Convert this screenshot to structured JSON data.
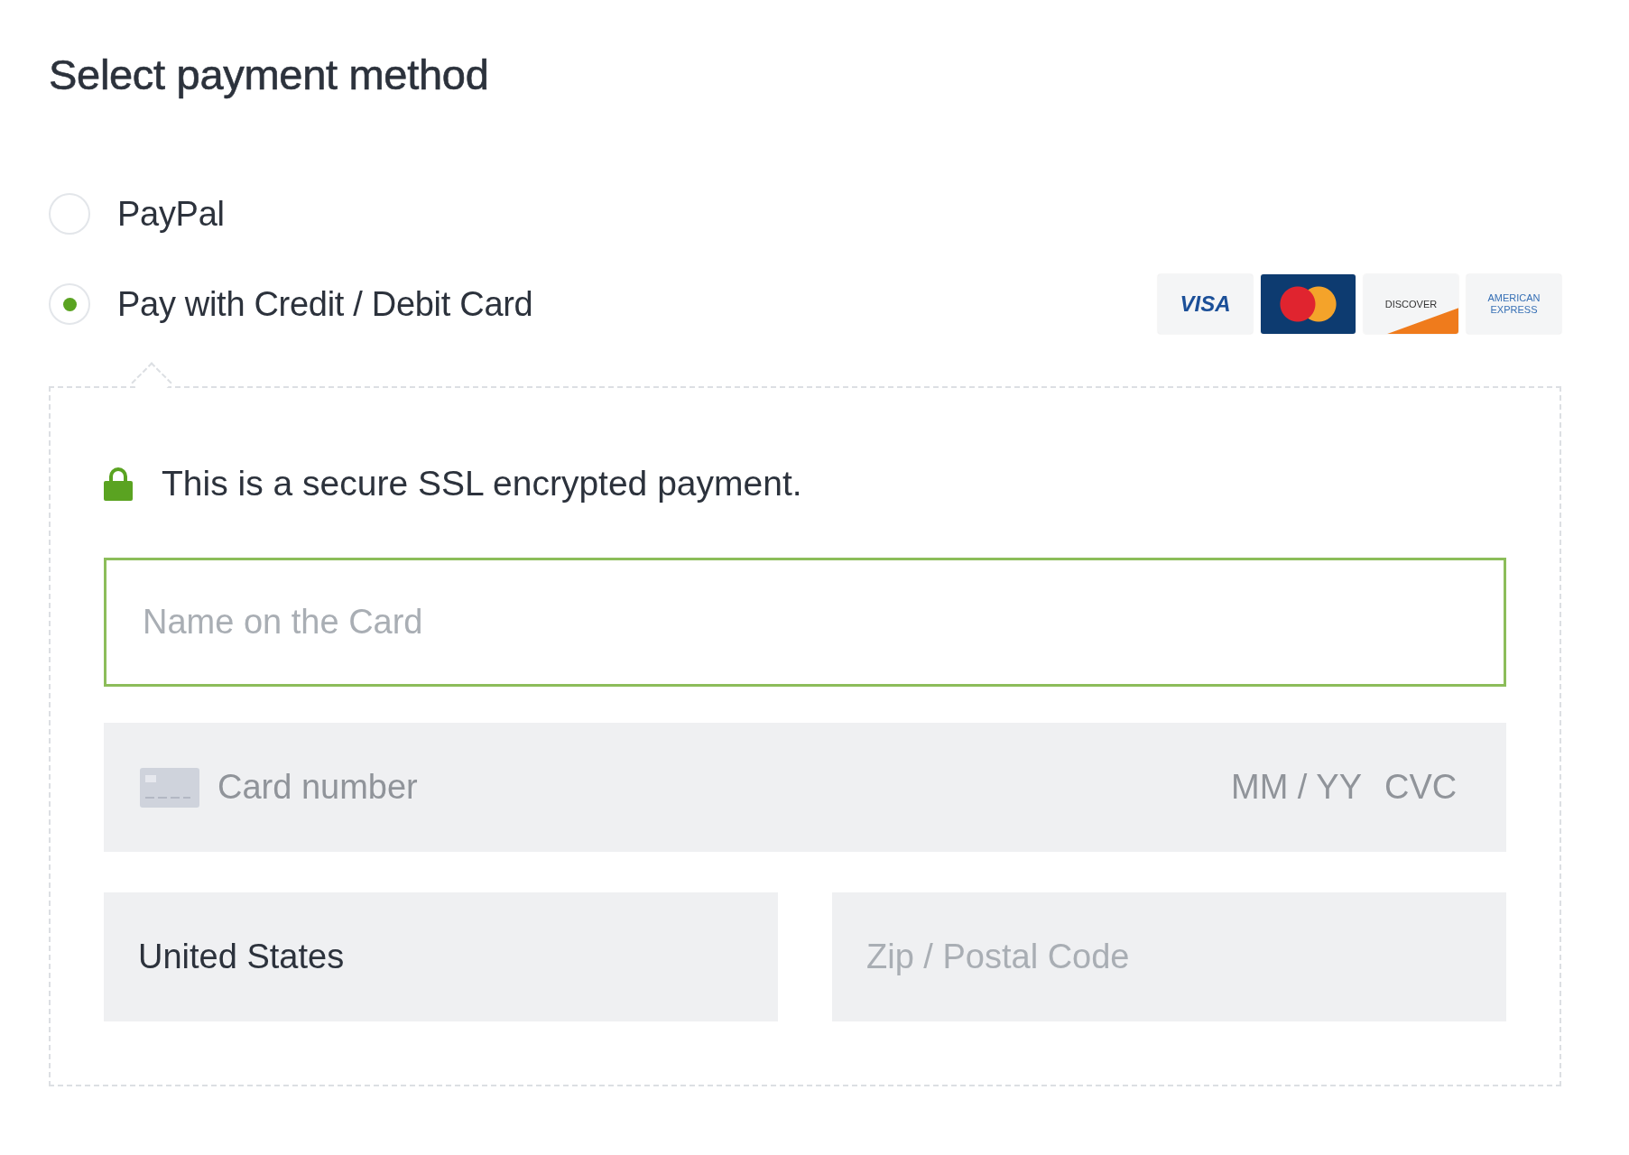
{
  "title": "Select payment method",
  "methods": [
    {
      "label": "PayPal",
      "selected": false
    },
    {
      "label": "Pay with Credit / Debit Card",
      "selected": true
    }
  ],
  "card_logos": [
    {
      "kind": "visa",
      "text": "VISA"
    },
    {
      "kind": "mastercard"
    },
    {
      "kind": "discover",
      "text": "DISCOVER"
    },
    {
      "kind": "amex",
      "text": "AMERICAN EXPRESS"
    }
  ],
  "secure_note": "This is a secure SSL encrypted payment.",
  "name_field": {
    "placeholder": "Name on the Card",
    "focused": true
  },
  "card_field": {
    "placeholder": "Card number",
    "expiry_placeholder": "MM / YY",
    "cvc_placeholder": "CVC"
  },
  "country_field": {
    "value": "United States"
  },
  "zip_field": {
    "placeholder": "Zip / Postal Code"
  }
}
